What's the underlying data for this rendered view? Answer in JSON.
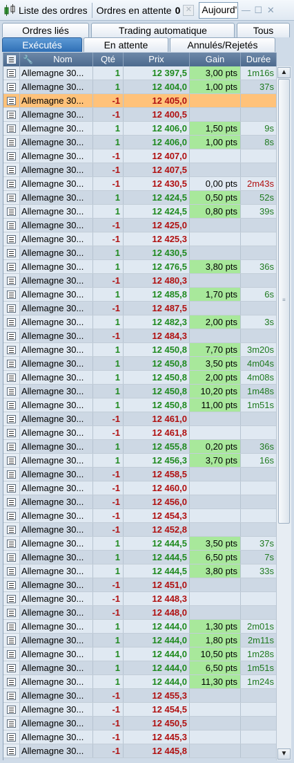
{
  "toolbar": {
    "orders_list_label": "Liste des ordres",
    "pending_label": "Ordres en attente",
    "pending_count": "0",
    "date_filter_value": "Aujourd'hui"
  },
  "tabs_row1": [
    "Ordres liés",
    "Trading automatique",
    "Tous"
  ],
  "tabs_row2": [
    "Exécutés",
    "En attente",
    "Annulés/Rejetés"
  ],
  "columns": {
    "nom": "Nom",
    "qte": "Qté",
    "prix": "Prix",
    "gain": "Gain",
    "duree": "Durée"
  },
  "colors": {
    "buy": "#1f8a1f",
    "sell": "#b01010",
    "gain_bg": "#a8e89b",
    "selected": "#ffc27a",
    "header": "#4c6a8e"
  },
  "rows": [
    {
      "nom": "Allemagne 30...",
      "qte": "1",
      "prix": "12 397,5",
      "gain": "3,00 pts",
      "duree": "1m16s"
    },
    {
      "nom": "Allemagne 30...",
      "qte": "1",
      "prix": "12 404,0",
      "gain": "1,00 pts",
      "duree": "37s"
    },
    {
      "nom": "Allemagne 30...",
      "qte": "-1",
      "prix": "12 405,0",
      "gain": "",
      "duree": "",
      "selected": true
    },
    {
      "nom": "Allemagne 30...",
      "qte": "-1",
      "prix": "12 400,5",
      "gain": "",
      "duree": ""
    },
    {
      "nom": "Allemagne 30...",
      "qte": "1",
      "prix": "12 406,0",
      "gain": "1,50 pts",
      "duree": "9s"
    },
    {
      "nom": "Allemagne 30...",
      "qte": "1",
      "prix": "12 406,0",
      "gain": "1,00 pts",
      "duree": "8s"
    },
    {
      "nom": "Allemagne 30...",
      "qte": "-1",
      "prix": "12 407,0",
      "gain": "",
      "duree": ""
    },
    {
      "nom": "Allemagne 30...",
      "qte": "-1",
      "prix": "12 407,5",
      "gain": "",
      "duree": ""
    },
    {
      "nom": "Allemagne 30...",
      "qte": "-1",
      "prix": "12 430,5",
      "gain": "0,00 pts",
      "duree": "2m43s",
      "neutral": true
    },
    {
      "nom": "Allemagne 30...",
      "qte": "1",
      "prix": "12 424,5",
      "gain": "0,50 pts",
      "duree": "52s"
    },
    {
      "nom": "Allemagne 30...",
      "qte": "1",
      "prix": "12 424,5",
      "gain": "0,80 pts",
      "duree": "39s"
    },
    {
      "nom": "Allemagne 30...",
      "qte": "-1",
      "prix": "12 425,0",
      "gain": "",
      "duree": ""
    },
    {
      "nom": "Allemagne 30...",
      "qte": "-1",
      "prix": "12 425,3",
      "gain": "",
      "duree": ""
    },
    {
      "nom": "Allemagne 30...",
      "qte": "1",
      "prix": "12 430,5",
      "gain": "",
      "duree": ""
    },
    {
      "nom": "Allemagne 30...",
      "qte": "1",
      "prix": "12 476,5",
      "gain": "3,80 pts",
      "duree": "36s"
    },
    {
      "nom": "Allemagne 30...",
      "qte": "-1",
      "prix": "12 480,3",
      "gain": "",
      "duree": ""
    },
    {
      "nom": "Allemagne 30...",
      "qte": "1",
      "prix": "12 485,8",
      "gain": "1,70 pts",
      "duree": "6s"
    },
    {
      "nom": "Allemagne 30...",
      "qte": "-1",
      "prix": "12 487,5",
      "gain": "",
      "duree": ""
    },
    {
      "nom": "Allemagne 30...",
      "qte": "1",
      "prix": "12 482,3",
      "gain": "2,00 pts",
      "duree": "3s"
    },
    {
      "nom": "Allemagne 30...",
      "qte": "-1",
      "prix": "12 484,3",
      "gain": "",
      "duree": ""
    },
    {
      "nom": "Allemagne 30...",
      "qte": "1",
      "prix": "12 450,8",
      "gain": "7,70 pts",
      "duree": "3m20s"
    },
    {
      "nom": "Allemagne 30...",
      "qte": "1",
      "prix": "12 450,8",
      "gain": "3,50 pts",
      "duree": "4m04s"
    },
    {
      "nom": "Allemagne 30...",
      "qte": "1",
      "prix": "12 450,8",
      "gain": "2,00 pts",
      "duree": "4m08s"
    },
    {
      "nom": "Allemagne 30...",
      "qte": "1",
      "prix": "12 450,8",
      "gain": "10,20 pts",
      "duree": "1m48s"
    },
    {
      "nom": "Allemagne 30...",
      "qte": "1",
      "prix": "12 450,8",
      "gain": "11,00 pts",
      "duree": "1m51s"
    },
    {
      "nom": "Allemagne 30...",
      "qte": "-1",
      "prix": "12 461,0",
      "gain": "",
      "duree": ""
    },
    {
      "nom": "Allemagne 30...",
      "qte": "-1",
      "prix": "12 461,8",
      "gain": "",
      "duree": ""
    },
    {
      "nom": "Allemagne 30...",
      "qte": "1",
      "prix": "12 455,8",
      "gain": "0,20 pts",
      "duree": "36s"
    },
    {
      "nom": "Allemagne 30...",
      "qte": "1",
      "prix": "12 456,3",
      "gain": "3,70 pts",
      "duree": "16s"
    },
    {
      "nom": "Allemagne 30...",
      "qte": "-1",
      "prix": "12 458,5",
      "gain": "",
      "duree": ""
    },
    {
      "nom": "Allemagne 30...",
      "qte": "-1",
      "prix": "12 460,0",
      "gain": "",
      "duree": ""
    },
    {
      "nom": "Allemagne 30...",
      "qte": "-1",
      "prix": "12 456,0",
      "gain": "",
      "duree": ""
    },
    {
      "nom": "Allemagne 30...",
      "qte": "-1",
      "prix": "12 454,3",
      "gain": "",
      "duree": ""
    },
    {
      "nom": "Allemagne 30...",
      "qte": "-1",
      "prix": "12 452,8",
      "gain": "",
      "duree": ""
    },
    {
      "nom": "Allemagne 30...",
      "qte": "1",
      "prix": "12 444,5",
      "gain": "3,50 pts",
      "duree": "37s"
    },
    {
      "nom": "Allemagne 30...",
      "qte": "1",
      "prix": "12 444,5",
      "gain": "6,50 pts",
      "duree": "7s"
    },
    {
      "nom": "Allemagne 30...",
      "qte": "1",
      "prix": "12 444,5",
      "gain": "3,80 pts",
      "duree": "33s"
    },
    {
      "nom": "Allemagne 30...",
      "qte": "-1",
      "prix": "12 451,0",
      "gain": "",
      "duree": ""
    },
    {
      "nom": "Allemagne 30...",
      "qte": "-1",
      "prix": "12 448,3",
      "gain": "",
      "duree": ""
    },
    {
      "nom": "Allemagne 30...",
      "qte": "-1",
      "prix": "12 448,0",
      "gain": "",
      "duree": ""
    },
    {
      "nom": "Allemagne 30...",
      "qte": "1",
      "prix": "12 444,0",
      "gain": "1,30 pts",
      "duree": "2m01s"
    },
    {
      "nom": "Allemagne 30...",
      "qte": "1",
      "prix": "12 444,0",
      "gain": "1,80 pts",
      "duree": "2m11s"
    },
    {
      "nom": "Allemagne 30...",
      "qte": "1",
      "prix": "12 444,0",
      "gain": "10,50 pts",
      "duree": "1m28s"
    },
    {
      "nom": "Allemagne 30...",
      "qte": "1",
      "prix": "12 444,0",
      "gain": "6,50 pts",
      "duree": "1m51s"
    },
    {
      "nom": "Allemagne 30...",
      "qte": "1",
      "prix": "12 444,0",
      "gain": "11,30 pts",
      "duree": "1m24s"
    },
    {
      "nom": "Allemagne 30...",
      "qte": "-1",
      "prix": "12 455,3",
      "gain": "",
      "duree": ""
    },
    {
      "nom": "Allemagne 30...",
      "qte": "-1",
      "prix": "12 454,5",
      "gain": "",
      "duree": ""
    },
    {
      "nom": "Allemagne 30...",
      "qte": "-1",
      "prix": "12 450,5",
      "gain": "",
      "duree": ""
    },
    {
      "nom": "Allemagne 30...",
      "qte": "-1",
      "prix": "12 445,3",
      "gain": "",
      "duree": ""
    },
    {
      "nom": "Allemagne 30...",
      "qte": "-1",
      "prix": "12 445,8",
      "gain": "",
      "duree": ""
    }
  ]
}
